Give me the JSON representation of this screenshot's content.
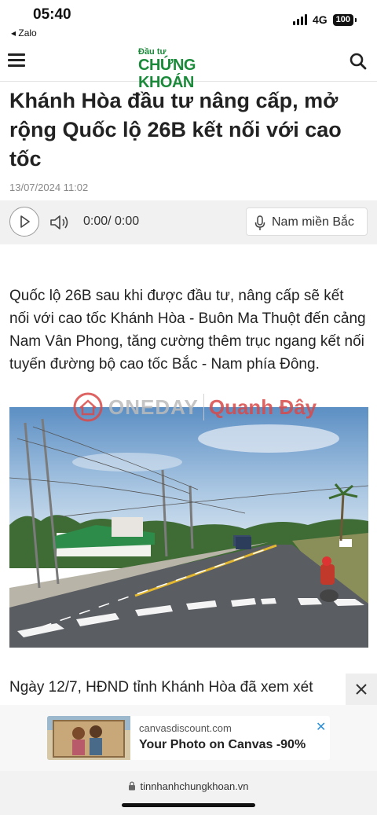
{
  "status_bar": {
    "time": "05:40",
    "back_app": "◂ Zalo",
    "network": "4G",
    "battery": "100"
  },
  "header": {
    "logo_top": "Đầu tư",
    "logo_main": "CHỨNG KHOÁN",
    "brand_color": "#1a8a3a"
  },
  "article": {
    "title": "Khánh Hòa đầu tư nâng cấp, mở rộng Quốc lộ 26B kết nối với cao tốc",
    "date": "13/07/2024 11:02",
    "lead": "Quốc lộ 26B sau khi được đầu tư, nâng cấp sẽ kết nối với cao tốc Khánh Hòa - Buôn Ma Thuột đến cảng Nam Vân Phong, tăng cường thêm trục ngang kết nối tuyến đường bộ cao tốc Bắc - Nam phía Đông.",
    "body_first_line": "Ngày 12/7, HĐND tỉnh Khánh Hòa đã xem xét"
  },
  "audio_player": {
    "time": "0:00/ 0:00",
    "voice_label": "Nam miền Bắc"
  },
  "watermark": {
    "left": "ONEDAY",
    "right": "Quanh Đây"
  },
  "ad": {
    "domain": "canvasdiscount.com",
    "headline": "Your Photo on Canvas -90%"
  },
  "browser": {
    "url": "tinnhanhchungkhoan.vn"
  },
  "icons": {
    "menu": "menu-icon",
    "search": "search-icon",
    "play": "play-icon",
    "volume": "volume-icon",
    "mic": "mic-icon",
    "close": "close-icon",
    "lock": "lock-icon"
  }
}
